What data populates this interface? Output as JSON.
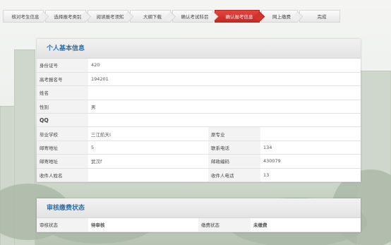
{
  "steps": [
    {
      "label": "核对考生信息"
    },
    {
      "label": "选择报考类别"
    },
    {
      "label": "阅读报考须知"
    },
    {
      "label": "大纲下载"
    },
    {
      "label": "确认考试科目"
    },
    {
      "label": "确认报考信息"
    },
    {
      "label": "网上缴费"
    },
    {
      "label": "完成"
    }
  ],
  "active_step": "确认报考信息",
  "personal": {
    "title": "个人基本信息",
    "id_label": "身份证号",
    "id_value": "420",
    "exam_no_label": "高考报名号",
    "exam_no_value": "194201",
    "name_label": "姓名",
    "name_value": "",
    "gender_label": "性别",
    "gender_value": "男",
    "qq_label": "QQ",
    "qq_value": "",
    "school_label": "毕业学校",
    "school_value": "三江航天I",
    "major_label": "原专业",
    "major_value": "",
    "mail_addr_label": "邮寄地址",
    "mail_addr_value": "5",
    "phone_label": "联系电话",
    "phone_value": "134",
    "mail_area_label": "邮寄地址",
    "mail_area_value": "武汉f",
    "postcode_label": "邮政编码",
    "postcode_value": "430079",
    "recipient_label": "收件人姓名",
    "recipient_value": "",
    "recipient_phone_label": "收件人电话",
    "recipient_phone_value": "13"
  },
  "review": {
    "title": "审核缴费状态",
    "review_label": "审核状态",
    "review_value": "待审核",
    "pay_label": "缴费状态",
    "pay_value": "未缴费"
  },
  "colors": {
    "accent": "#d0231d",
    "heading": "#2f6fa6"
  }
}
